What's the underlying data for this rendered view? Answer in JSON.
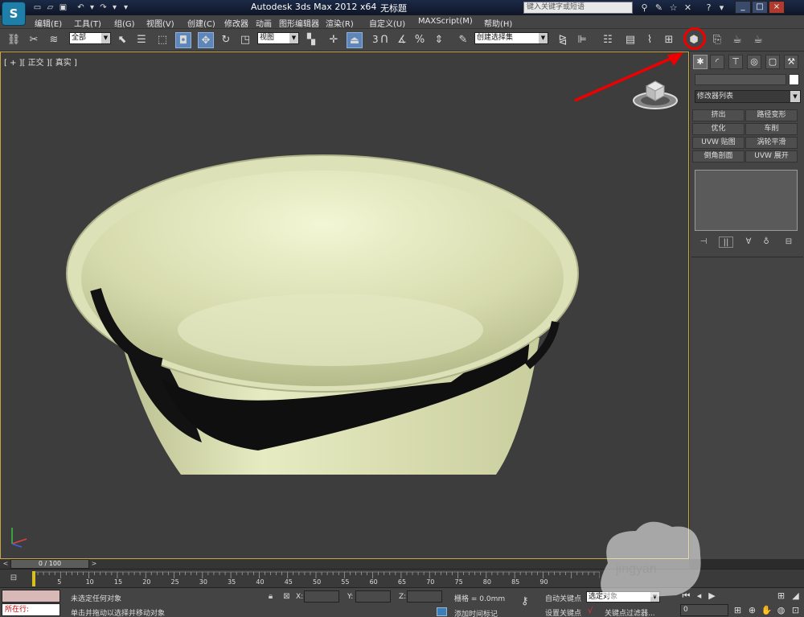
{
  "titlebar": {
    "logo": "S",
    "title": "Autodesk 3ds Max  2012 x64",
    "filename": "无标题",
    "search_placeholder": "键入关键字或短语",
    "window_controls": [
      "_",
      "□",
      "×"
    ]
  },
  "menu": {
    "items": [
      "编辑(E)",
      "工具(T)",
      "组(G)",
      "视图(V)",
      "创建(C)",
      "修改器",
      "动画",
      "图形编辑器",
      "渲染(R)",
      "自定义(U)",
      "MAXScript(M)",
      "帮助(H)"
    ]
  },
  "toolbar": {
    "selection_filter": "全部",
    "reference_coord": "视图",
    "snap_number": "3",
    "named_selection": "创建选择集"
  },
  "viewport": {
    "label": "[ + ][ 正交 ][ 真实 ]",
    "colors": {
      "background": "#3d3d3d",
      "border": "#c9a644",
      "bowl": "#d5dab0"
    }
  },
  "command_panel": {
    "modifier_list": "修改器列表",
    "buttons": [
      "挤出",
      "路径变形",
      "优化",
      "车削",
      "UVW 贴图",
      "涡轮平滑",
      "倒角剖面",
      "UVW 展开"
    ]
  },
  "time_slider": {
    "position": "0 / 100"
  },
  "trackbar": {
    "ticks": [
      "5",
      "10",
      "15",
      "20",
      "25",
      "30",
      "35",
      "40",
      "45",
      "50",
      "55",
      "60",
      "65",
      "70",
      "75",
      "80",
      "85",
      "90"
    ]
  },
  "status": {
    "maxscript_output": "所在行:",
    "selection": "未选定任何对象",
    "prompt": "单击并拖动以选择并移动对象",
    "x_label": "X:",
    "y_label": "Y:",
    "z_label": "Z:",
    "grid": "栅格 = 0.0mm",
    "add_time_tag": "添加时间标记",
    "auto_key": "自动关键点",
    "key_mode": "选定对象",
    "set_key": "设置关键点",
    "key_filters": "关键点过滤器...",
    "current_frame": "0"
  },
  "watermark": "jingyan"
}
